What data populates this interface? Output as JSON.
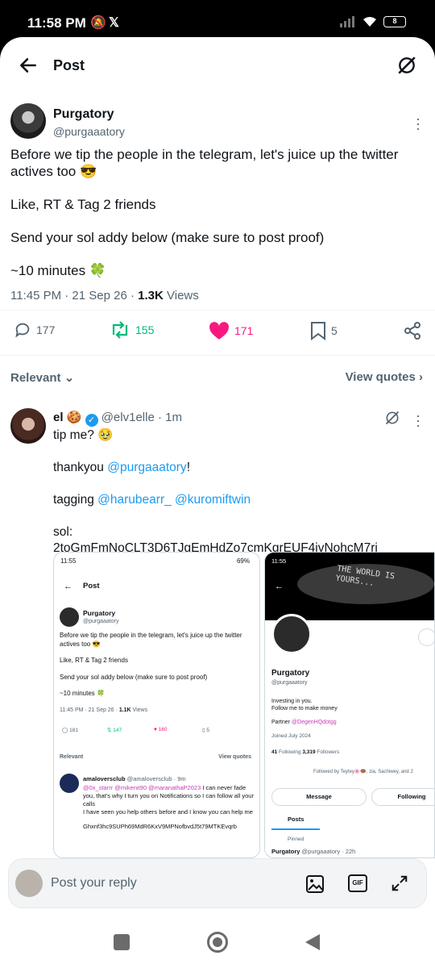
{
  "status": {
    "time": "11:58 PM",
    "battery": "8"
  },
  "header": {
    "title": "Post"
  },
  "post": {
    "name": "Purgatory",
    "handle": "@purgaaatory",
    "line1": "Before we tip the people in the telegram, let's juice up the twitter actives too 😎",
    "line2": "Like, RT & Tag 2 friends",
    "line3": "Send your sol addy below (make sure to post proof)",
    "line4": "~10 minutes 🍀",
    "time": "11:45 PM · 21 Sep 26 · ",
    "views": "1.3K",
    "views_label": " Views",
    "replies": "177",
    "reposts": "155",
    "likes": "171",
    "bookmarks": "5"
  },
  "filter": {
    "relevant": "Relevant",
    "view_quotes": "View quotes"
  },
  "reply": {
    "name": "el 🍪",
    "handle": "@elv1elle · 1m",
    "line1": "tip me? 🥹",
    "thank_prefix": "thankyou ",
    "thank_mention": "@purgaaatory",
    "thank_suffix": "!",
    "tag_prefix": "tagging ",
    "tag_mention1": "@harubearr_",
    "tag_mention2": "@kuromiftwin",
    "sol_label": "sol:",
    "sol_address": "2toGmFmNoCLT3D6TJgEmHdZo7cmKqrEUF4ivNohcM7rj"
  },
  "shot_left": {
    "time": "11:55",
    "battery": "69%",
    "title": "Post",
    "name": "Purgatory",
    "handle": "@purgaaatory",
    "line1": "Before we tip the people in the telegram, let's juice up the twitter actives too 😎",
    "line2": "Like, RT & Tag 2 friends",
    "line3": "Send your sol addy below (make sure to post proof)",
    "line4": "~10 minutes 🍀",
    "meta": "11:45 PM · 21 Sep 26 · ",
    "views": "1.1K",
    "views_label": " Views",
    "replies": "181",
    "reposts": "147",
    "likes": "160",
    "bookmarks": "5",
    "relevant": "Relevant",
    "view_quotes": "View quotes",
    "q_name": "amaloversclub",
    "q_handle": "@amaloversclub · 9m",
    "q_mentions": "@0x_starrr @mikenit90 @maranathaP2023",
    "q_text1": " I can never fade you, that's why I turn you on Notifications so I can follow all your calls",
    "q_text2": "I have seen you help others before and I know you can help me",
    "q_addr": "Ghxnf3hc9SUPh69MdR6KxV9MPNofbvdJ5t79MTKEvqrb"
  },
  "shot_right": {
    "time": "11:55",
    "banner": "THE WORLD IS YOURS...",
    "name": "Purgatory",
    "handle": "@purgaaatory",
    "bio1": "Investing in you.",
    "bio2": "Follow me to make money",
    "partner_label": "Partner ",
    "partner": "@DegenHQdotgg",
    "joined": "Joined July 2024",
    "following_count": "41",
    "following_label": " Following",
    "followers_count": "3,319",
    "followers_label": " Followers",
    "followed_by": "Followed by Teytey🌸🍩, zia, Sachiwey, and 2",
    "message_btn": "Message",
    "following_btn": "Following",
    "tab_posts": "Posts",
    "pinned": "Pinned",
    "pinned_name": "Purgatory",
    "pinned_handle": "@purgaaatory · 22h"
  },
  "replybar": {
    "placeholder": "Post your reply"
  },
  "colors": {
    "accent": "#1d9bf0",
    "retweet": "#00ba7c",
    "like": "#f91880",
    "text_secondary": "#536471"
  }
}
